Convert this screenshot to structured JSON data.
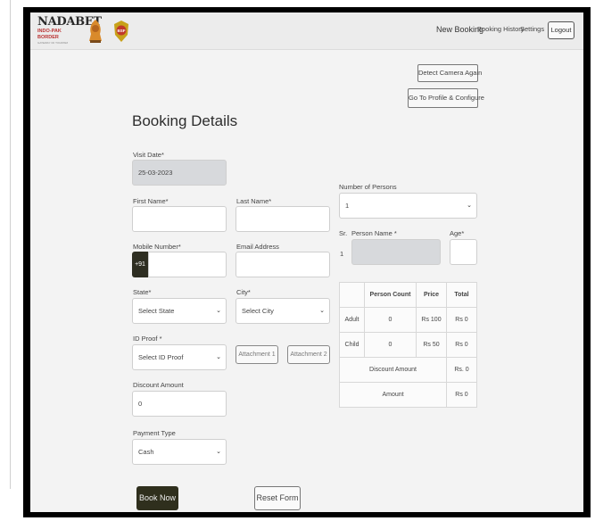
{
  "header": {
    "logo_main": "NADABET",
    "logo_sub": "INDO-PAK BORDER",
    "logo_tag": "GATEWAY OF TOURISM",
    "nav": {
      "new_booking": "New Booking",
      "booking_history": "Booking History",
      "settings": "Settings",
      "logout": "Logout"
    }
  },
  "actions": {
    "detect_camera": "Detect Camera Again",
    "profile_configure": "Go To Profile & Configure"
  },
  "form": {
    "title": "Booking Details",
    "visit_date": {
      "label": "Visit Date*",
      "value": "25-03-2023"
    },
    "first_name": {
      "label": "First Name*",
      "value": ""
    },
    "last_name": {
      "label": "Last Name*",
      "value": ""
    },
    "mobile": {
      "label": "Mobile Number*",
      "prefix": "+91",
      "value": ""
    },
    "email": {
      "label": "Email Address",
      "value": ""
    },
    "state": {
      "label": "State*",
      "selected": "Select State"
    },
    "city": {
      "label": "City*",
      "selected": "Select City"
    },
    "id_proof": {
      "label": "ID Proof *",
      "selected": "Select ID Proof"
    },
    "attachment1": "Attachment 1",
    "attachment2": "Attachment 2",
    "discount": {
      "label": "Discount Amount",
      "value": "0"
    },
    "payment": {
      "label": "Payment Type",
      "selected": "Cash"
    },
    "number_of_persons": {
      "label": "Number of Persons",
      "selected": "1"
    },
    "persons": {
      "sr_label": "Sr.",
      "name_label": "Person Name *",
      "age_label": "Age*",
      "rows": [
        {
          "sr": "1",
          "name": "",
          "age": ""
        }
      ]
    }
  },
  "price_table": {
    "headers": [
      "",
      "Person Count",
      "Price",
      "Total"
    ],
    "rows": [
      {
        "type": "Adult",
        "count": "0",
        "price": "Rs 100",
        "total": "Rs 0"
      },
      {
        "type": "Child",
        "count": "0",
        "price": "Rs 50",
        "total": "Rs 0"
      }
    ],
    "discount_label": "Discount Amount",
    "discount_value": "Rs. 0",
    "amount_label": "Amount",
    "amount_value": "Rs 0"
  },
  "footer": {
    "book_now": "Book Now",
    "reset_form": "Reset Form"
  }
}
